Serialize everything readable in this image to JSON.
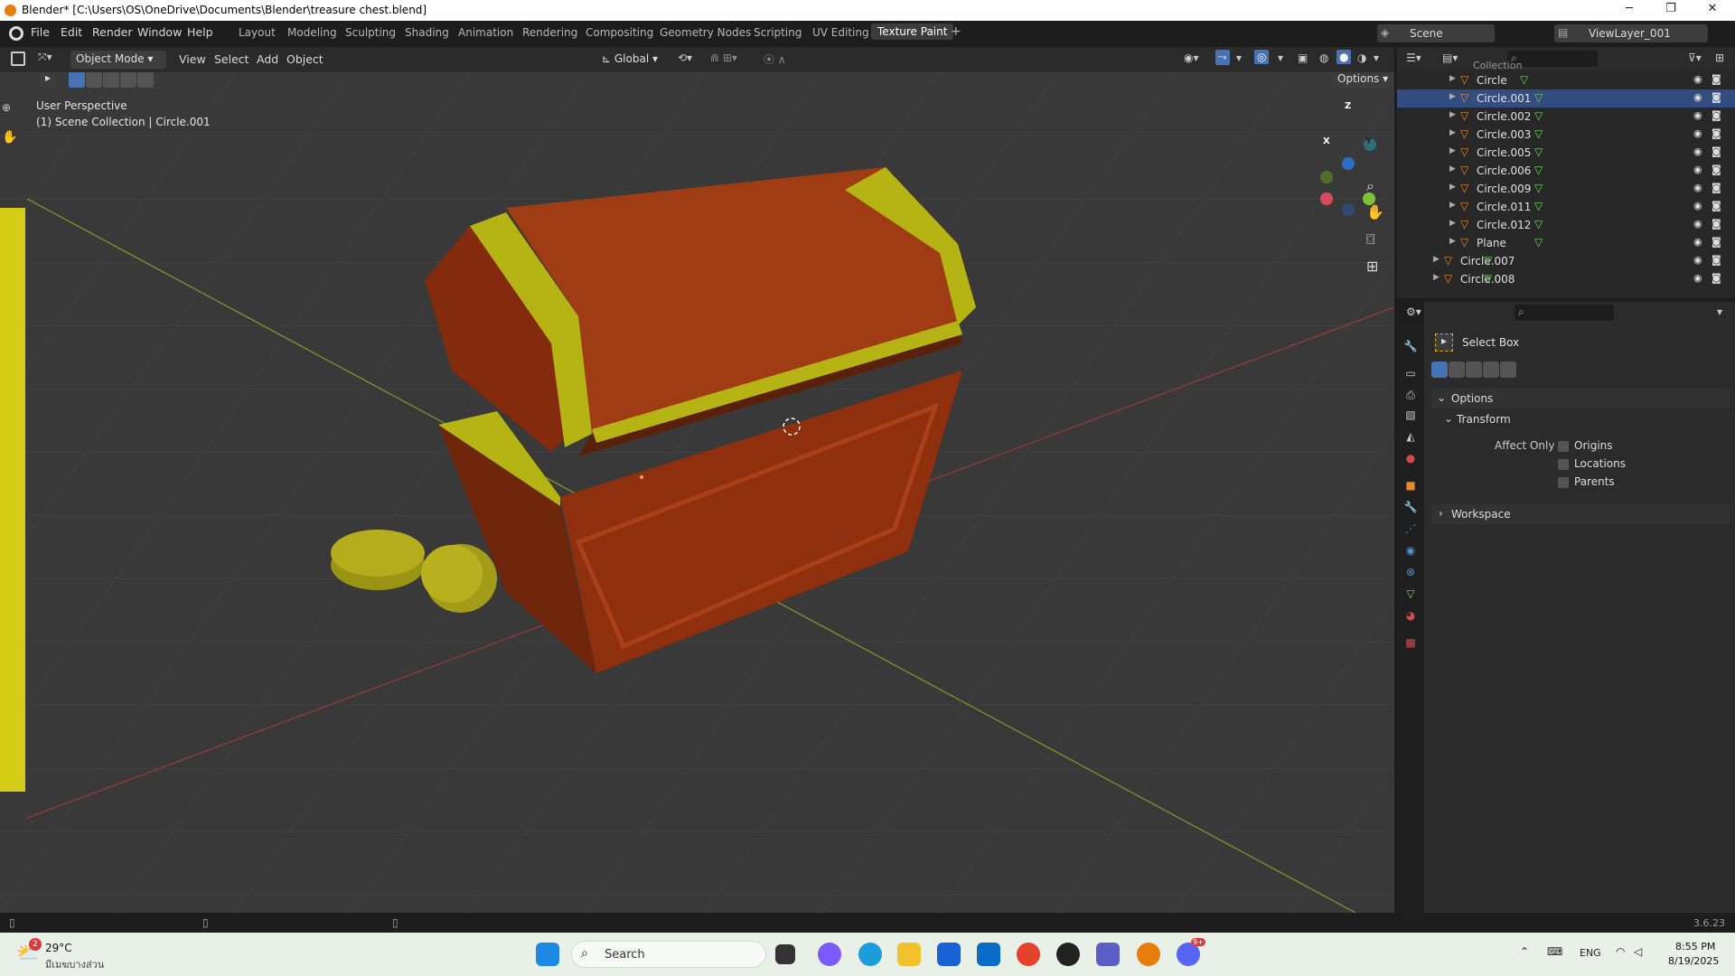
{
  "window": {
    "title": "Blender* [C:\\Users\\OS\\OneDrive\\Documents\\Blender\\treasure chest.blend]",
    "minimize": "─",
    "restore": "❐",
    "close": "✕"
  },
  "menu": {
    "file": "File",
    "edit": "Edit",
    "render": "Render",
    "window": "Window",
    "help": "Help"
  },
  "workspaces": [
    "Layout",
    "Modeling",
    "Sculpting",
    "Shading",
    "Animation",
    "Rendering",
    "Compositing",
    "Geometry Nodes",
    "Scripting",
    "UV Editing",
    "Texture Paint"
  ],
  "workspace_add": "+",
  "scene": {
    "name": "Scene",
    "viewlayer": "ViewLayer_001"
  },
  "viewport_header": {
    "mode": "Object Mode",
    "view": "View",
    "select": "Select",
    "add": "Add",
    "object": "Object",
    "orientation": "Global",
    "options": "Options"
  },
  "viewport": {
    "perspective": "User Perspective",
    "collection_info": "(1) Scene Collection | Circle.001",
    "gizmo_x": "X",
    "gizmo_y": "Y",
    "gizmo_z": "Z"
  },
  "outliner": {
    "collection": "Collection",
    "items": [
      {
        "name": "Circle",
        "selected": false
      },
      {
        "name": "Circle.001",
        "selected": true
      },
      {
        "name": "Circle.002",
        "selected": false
      },
      {
        "name": "Circle.003",
        "selected": false
      },
      {
        "name": "Circle.005",
        "selected": false
      },
      {
        "name": "Circle.006",
        "selected": false
      },
      {
        "name": "Circle.009",
        "selected": false
      },
      {
        "name": "Circle.011",
        "selected": false
      },
      {
        "name": "Circle.012",
        "selected": false
      },
      {
        "name": "Plane",
        "selected": false
      },
      {
        "name": "Circle.007",
        "selected": false
      },
      {
        "name": "Circle.008",
        "selected": false
      }
    ]
  },
  "properties": {
    "tool": "Select Box",
    "options": "Options",
    "transform": "Transform",
    "affect_only": "Affect Only",
    "origins": "Origins",
    "locations": "Locations",
    "parents": "Parents",
    "workspace": "Workspace"
  },
  "status": {
    "version": "3.6.23"
  },
  "taskbar": {
    "weather_temp": "29°C",
    "weather_desc": "มีเมฆบางส่วน",
    "weather_badge": "2",
    "search": "Search",
    "lang": "ENG",
    "time": "8:55 PM",
    "date": "8/19/2025",
    "discord_badge": "9+"
  },
  "colors": {
    "accent": "#e87d0d",
    "selected_row": "#334d80",
    "chest": "#8e2f0e",
    "trim": "#b5b414"
  }
}
